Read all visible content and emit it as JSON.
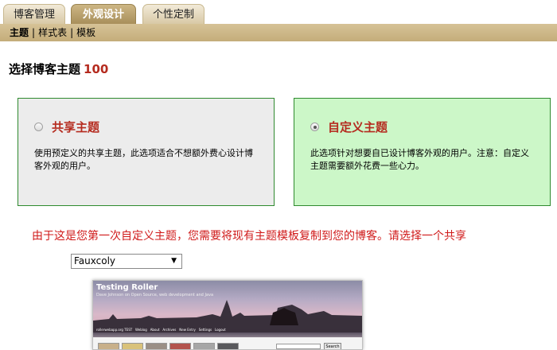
{
  "tabs": [
    {
      "label": "博客管理",
      "active": false
    },
    {
      "label": "外观设计",
      "active": true
    },
    {
      "label": "个性定制",
      "active": false
    }
  ],
  "subnav": {
    "items": [
      "主题",
      "样式表",
      "模板"
    ],
    "current": "主题",
    "separator": "|"
  },
  "heading": {
    "text": "选择博客主题",
    "count": "100"
  },
  "options": {
    "shared": {
      "title": "共享主题",
      "desc": "使用预定义的共享主题，此选项适合不想额外费心设计博客外观的用户。",
      "selected": false
    },
    "custom": {
      "title": "自定义主题",
      "desc": "此选项针对想要自已设计博客外观的用户。注意：自定义主题需要额外花费一些心力。",
      "selected": true
    }
  },
  "notice": "由于这是您第一次自定义主题，您需要将现有主题模板复制到您的博客。请选择一个共享",
  "theme_select": {
    "value": "Fauxcoly",
    "arrow": "▼"
  },
  "preview": {
    "title": "Testing Roller",
    "subtitle": "Dave Johnson on Open Source, web development and Java",
    "nav": [
      "rollerwebapp.org TEST",
      "Weblog",
      "About",
      "Archives",
      "New Entry",
      "Settings",
      "Logout"
    ],
    "search_button": "Search"
  },
  "colors": {
    "accent_red": "#b52b1f",
    "notice_red": "#d01b1b",
    "tab_active": "#a88f5b",
    "card_border": "#2f8a2f",
    "selected_card_bg": "#ccf7c8",
    "unselected_card_bg": "#ececec"
  }
}
